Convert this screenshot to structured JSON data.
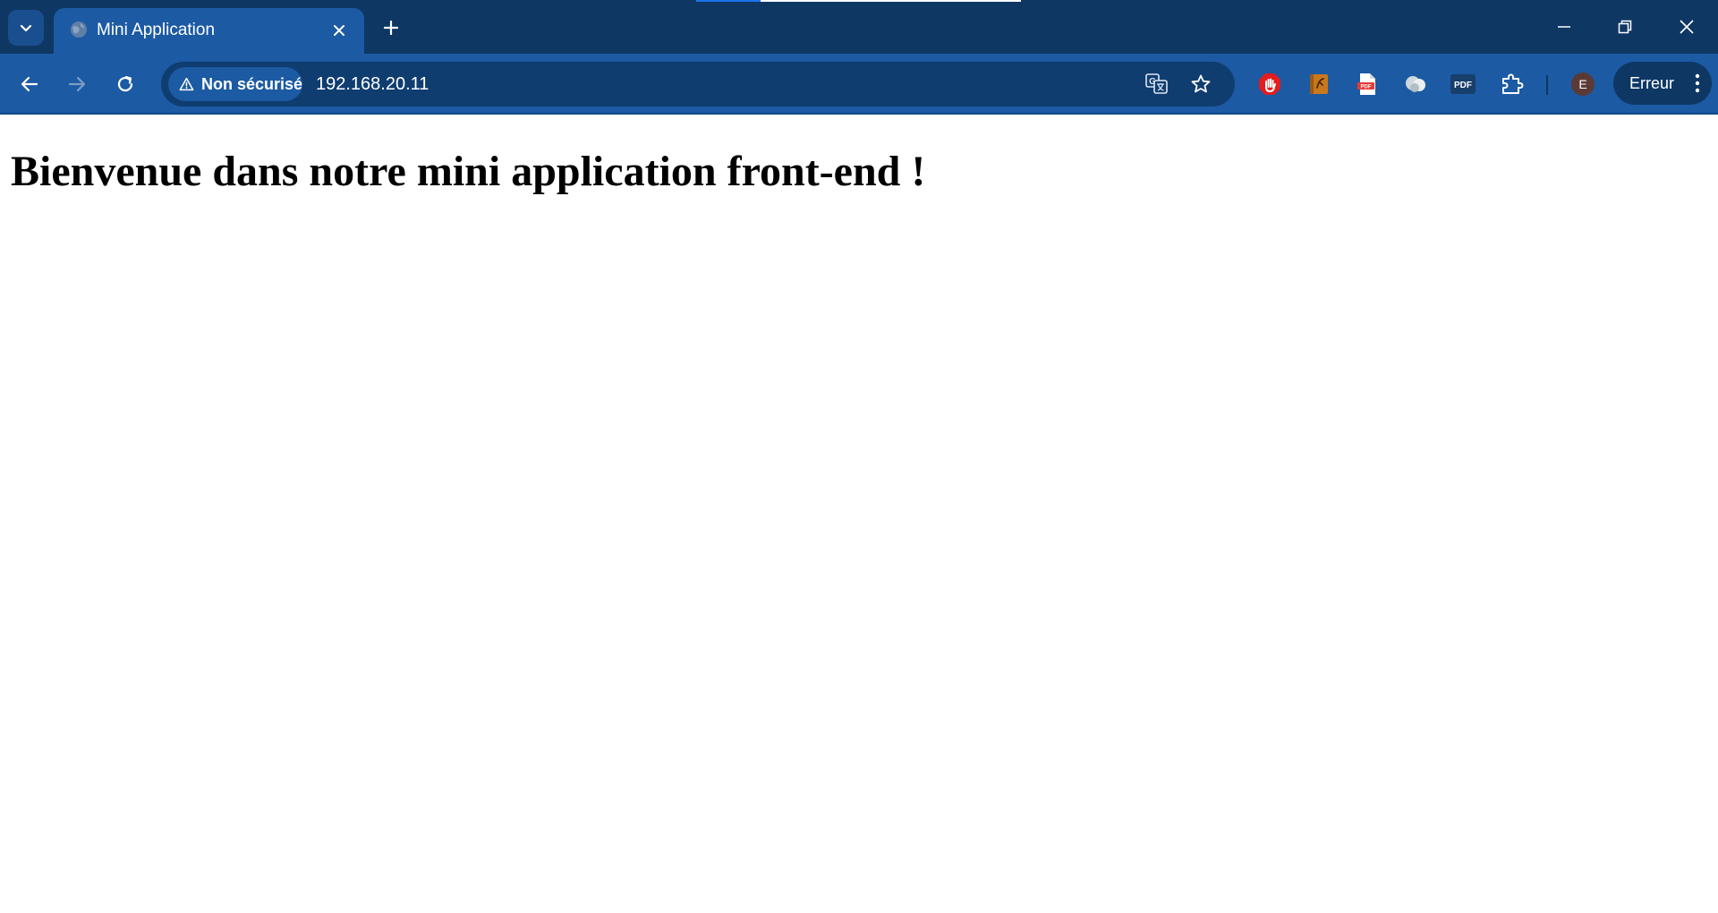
{
  "browser": {
    "tab": {
      "title": "Mini Application"
    },
    "address_bar": {
      "security_label": "Non sécurisé",
      "url": "192.168.20.11"
    },
    "profile": {
      "initial": "E"
    },
    "error_button_label": "Erreur",
    "extensions": [
      {
        "icon": "red-stop-hand-icon",
        "color": "#e11d1d"
      },
      {
        "icon": "orange-book-icon",
        "color": "#c9781e"
      },
      {
        "icon": "pdf-file-icon",
        "color": "#e53935"
      },
      {
        "icon": "grey-circles-icon",
        "color": "#cfd8dc"
      },
      {
        "icon": "pdf-text-icon",
        "label": "PDF"
      },
      {
        "icon": "puzzle-extensions-icon"
      }
    ],
    "colors": {
      "titlebar": "#0e3764",
      "toolbar": "#1c5aa3",
      "omnibox": "#0f3d70",
      "loading_accent": "#1a73e8"
    }
  },
  "page": {
    "heading": "Bienvenue dans notre mini application front-end !"
  }
}
